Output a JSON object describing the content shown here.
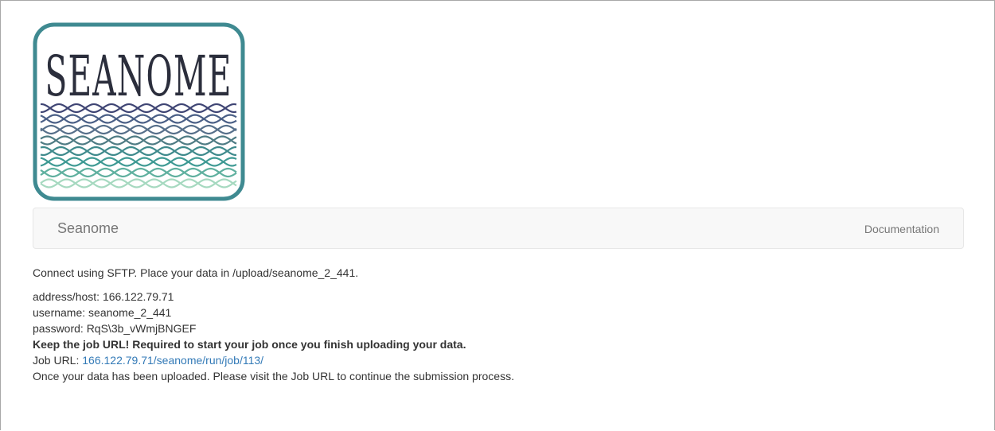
{
  "logo": {
    "text": "SEANOME",
    "frame_color": "#3f8a91",
    "letter_color": "#2b2e3c",
    "wave_colors": [
      "#3f4574",
      "#4a5f86",
      "#566f8a",
      "#4f7c84",
      "#3f8a8c",
      "#3f9a94",
      "#5fb09f",
      "#a6d9c0"
    ]
  },
  "navbar": {
    "brand": "Seanome",
    "documentation": "Documentation"
  },
  "content": {
    "intro": "Connect using SFTP. Place your data in /upload/seanome_2_441.",
    "address": "address/host: 166.122.79.71",
    "username": "username: seanome_2_441",
    "password": "password: RqS\\3b_vWmjBNGEF",
    "warning": "Keep the job URL! Required to start your job once you finish uploading your data.",
    "job_url_label": "Job URL: ",
    "job_url": "166.122.79.71/seanome/run/job/113/",
    "final_note": "Once your data has been uploaded. Please visit the Job URL to continue the submission process."
  },
  "colors": {
    "link": "#337ab7",
    "nav_text": "#777777",
    "navbar_bg": "#f8f8f8",
    "text": "#333333"
  }
}
